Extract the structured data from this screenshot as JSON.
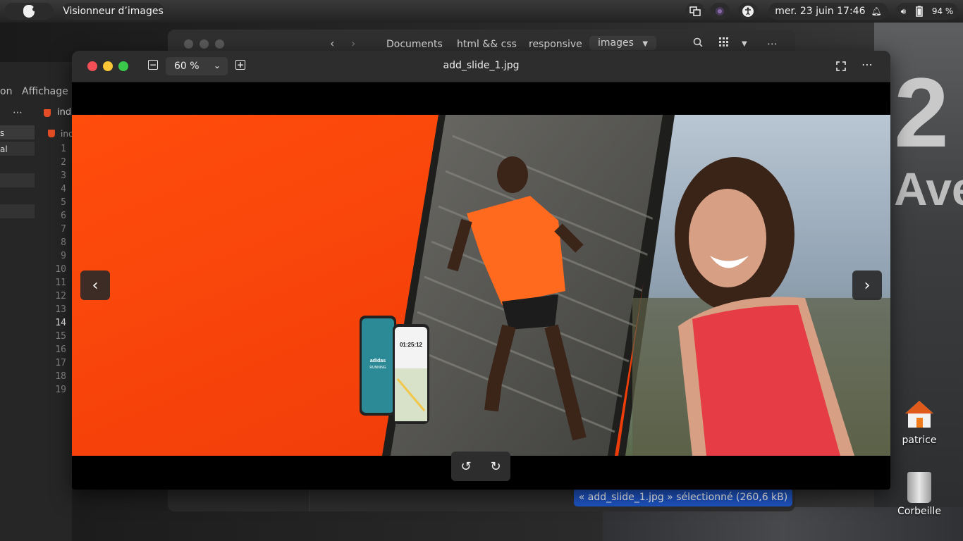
{
  "topbar": {
    "app_name": "Visionneur d’images",
    "clock": "mer. 23 juin  17:46",
    "battery": "94 %",
    "icons": [
      "apple-icon",
      "screen-icon",
      "record-icon",
      "accessibility-icon",
      "bell-icon",
      "volume-icon",
      "battery-icon"
    ]
  },
  "file_manager": {
    "breadcrumbs": [
      "Documents",
      "html && css",
      "responsive",
      "images"
    ],
    "selection_status": "« add_slide_1.jpg » sélectionné  (260,6 kB)"
  },
  "editor": {
    "menu_partial": "on",
    "menu_item": "Affichage",
    "more": "⋯",
    "tab_partial": "ind",
    "file_partial": "inc",
    "side_rows": [
      "s",
      "al"
    ],
    "line_numbers": [
      "1",
      "2",
      "3",
      "4",
      "5",
      "6",
      "7",
      "8",
      "9",
      "10",
      "11",
      "12",
      "13",
      "14",
      "15",
      "16",
      "17",
      "18",
      "19"
    ],
    "current_line": "14"
  },
  "viewer": {
    "title": "add_slide_1.jpg",
    "zoom_level": "60 %",
    "zoom_minus": "−",
    "zoom_plus": "+",
    "menu": "⋯",
    "prev": "‹",
    "next": "›",
    "rotate_left": "↺",
    "rotate_right": "↻"
  },
  "photo": {
    "brand": "adidas",
    "sub": "RUNNING",
    "phone_time": "01:25:12"
  },
  "desktop": {
    "home_label": "patrice",
    "trash_label": "Corbeille",
    "sign_big": "2",
    "sign_text": "Ave"
  },
  "colors": {
    "accent_selection": "#1f56c7",
    "orange": "#ff4a10",
    "close": "#f25056",
    "minimize": "#fac536",
    "maximize": "#39c84a"
  }
}
